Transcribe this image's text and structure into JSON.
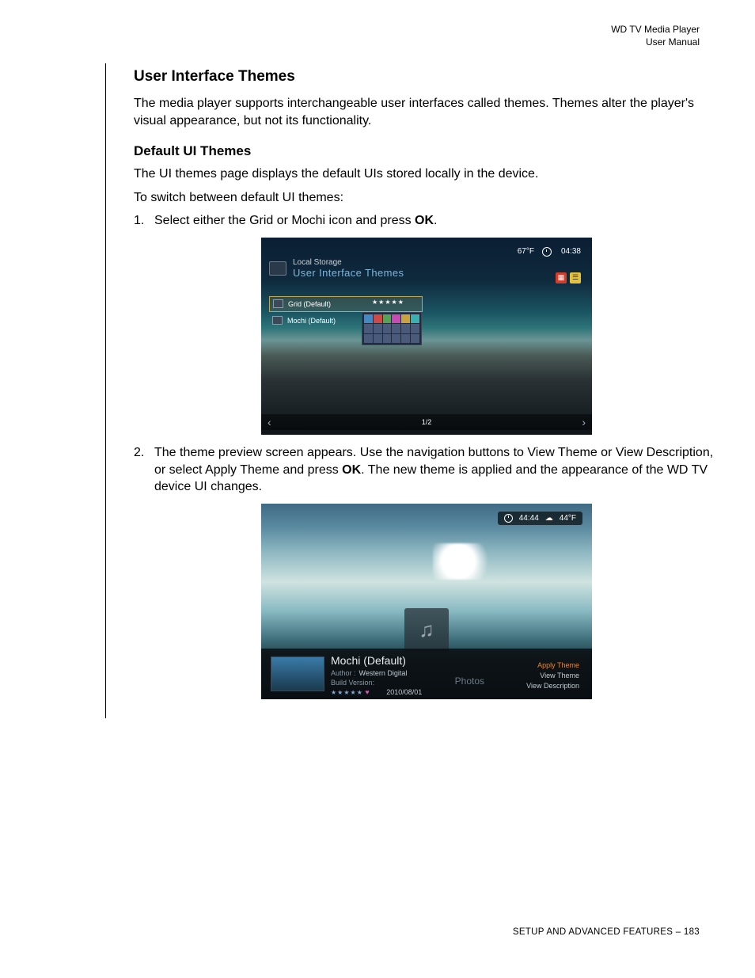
{
  "header": {
    "line1": "WD TV Media Player",
    "line2": "User Manual"
  },
  "section": {
    "h2": "User Interface Themes",
    "p1": "The media player supports interchangeable user interfaces called themes. Themes alter the player's visual appearance, but not its functionality.",
    "h3": "Default UI Themes",
    "p2": "The UI themes page displays the default UIs stored locally in the device.",
    "p3": "To switch between default UI themes:",
    "step1_num": "1.",
    "step1_a": "Select either the Grid or Mochi icon and press ",
    "step1_b": "OK",
    "step1_c": ".",
    "step2_num": "2.",
    "step2_a": "The theme preview screen appears. Use the navigation buttons to View Theme or View Description, or select Apply Theme and press ",
    "step2_b": "OK",
    "step2_c": ". The new theme is applied and the appearance of the WD TV device UI changes."
  },
  "shot1": {
    "temp": "67°F",
    "time": "04:38",
    "breadcrumb": "Local Storage",
    "title": "User Interface Themes",
    "row1": "Grid (Default)",
    "row2": "Mochi (Default)",
    "stars": "★★★★★",
    "pager": "1/2"
  },
  "shot2": {
    "time": "44:44",
    "temp": "44°F",
    "note": "♫",
    "title": "Mochi (Default)",
    "author_lbl": "Author :",
    "author_val": "Western Digital",
    "build_lbl": "Build Version:",
    "date": "2010/08/01",
    "stars": "★★★★★",
    "heart": "♥",
    "photos": "Photos",
    "act_apply": "Apply Theme",
    "act_view": "View Theme",
    "act_desc": "View Description"
  },
  "footer": {
    "section": "SETUP AND ADVANCED FEATURES",
    "sep": " – ",
    "page": "183"
  }
}
